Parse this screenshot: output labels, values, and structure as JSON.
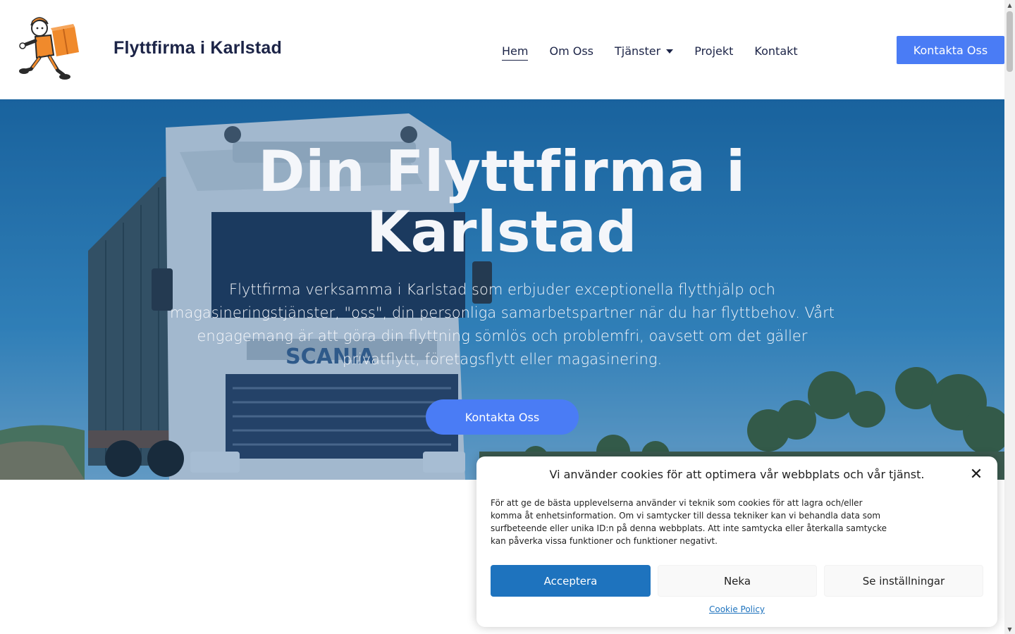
{
  "header": {
    "logo_alt": "moving-man-logo",
    "site_title": "Flyttfirma i Karlstad",
    "nav": [
      {
        "label": "Hem",
        "active": true
      },
      {
        "label": "Om Oss"
      },
      {
        "label": "Tjänster",
        "has_dropdown": true
      },
      {
        "label": "Projekt"
      },
      {
        "label": "Kontakt"
      }
    ],
    "cta_label": "Kontakta Oss"
  },
  "hero": {
    "title": "Din Flyttfirma i Karlstad",
    "text": "Flyttfirma verksamma i Karlstad som erbjuder exceptionella flytthjälp och magasineringstjänster, \"oss\", din personliga samarbetspartner när du har flyttbehov. Vårt engagemang är att göra din flyttning sömlös och problemfri, oavsett om det gäller privatflytt, företagsflytt eller magasinering.",
    "cta_label": "Kontakta Oss",
    "truck_brand": "SCANIA"
  },
  "cookie": {
    "title": "Vi använder cookies för att optimera vår webbplats och vår tjänst.",
    "text": "För att ge de bästa upplevelserna använder vi teknik som cookies för att lagra och/eller komma åt enhetsinformation. Om vi samtycker till dessa tekniker kan vi behandla data som surfbeteende eller unika ID:n på denna webbplats. Att inte samtycka eller återkalla samtycke kan påverka vissa funktioner och funktioner negativt.",
    "accept_label": "Acceptera",
    "deny_label": "Neka",
    "settings_label": "Se inställningar",
    "policy_label": "Cookie Policy",
    "close_glyph": "✕"
  },
  "colors": {
    "accent": "#4a7cf5",
    "cookie_accent": "#1e73be",
    "title_navy": "#1c2447"
  }
}
